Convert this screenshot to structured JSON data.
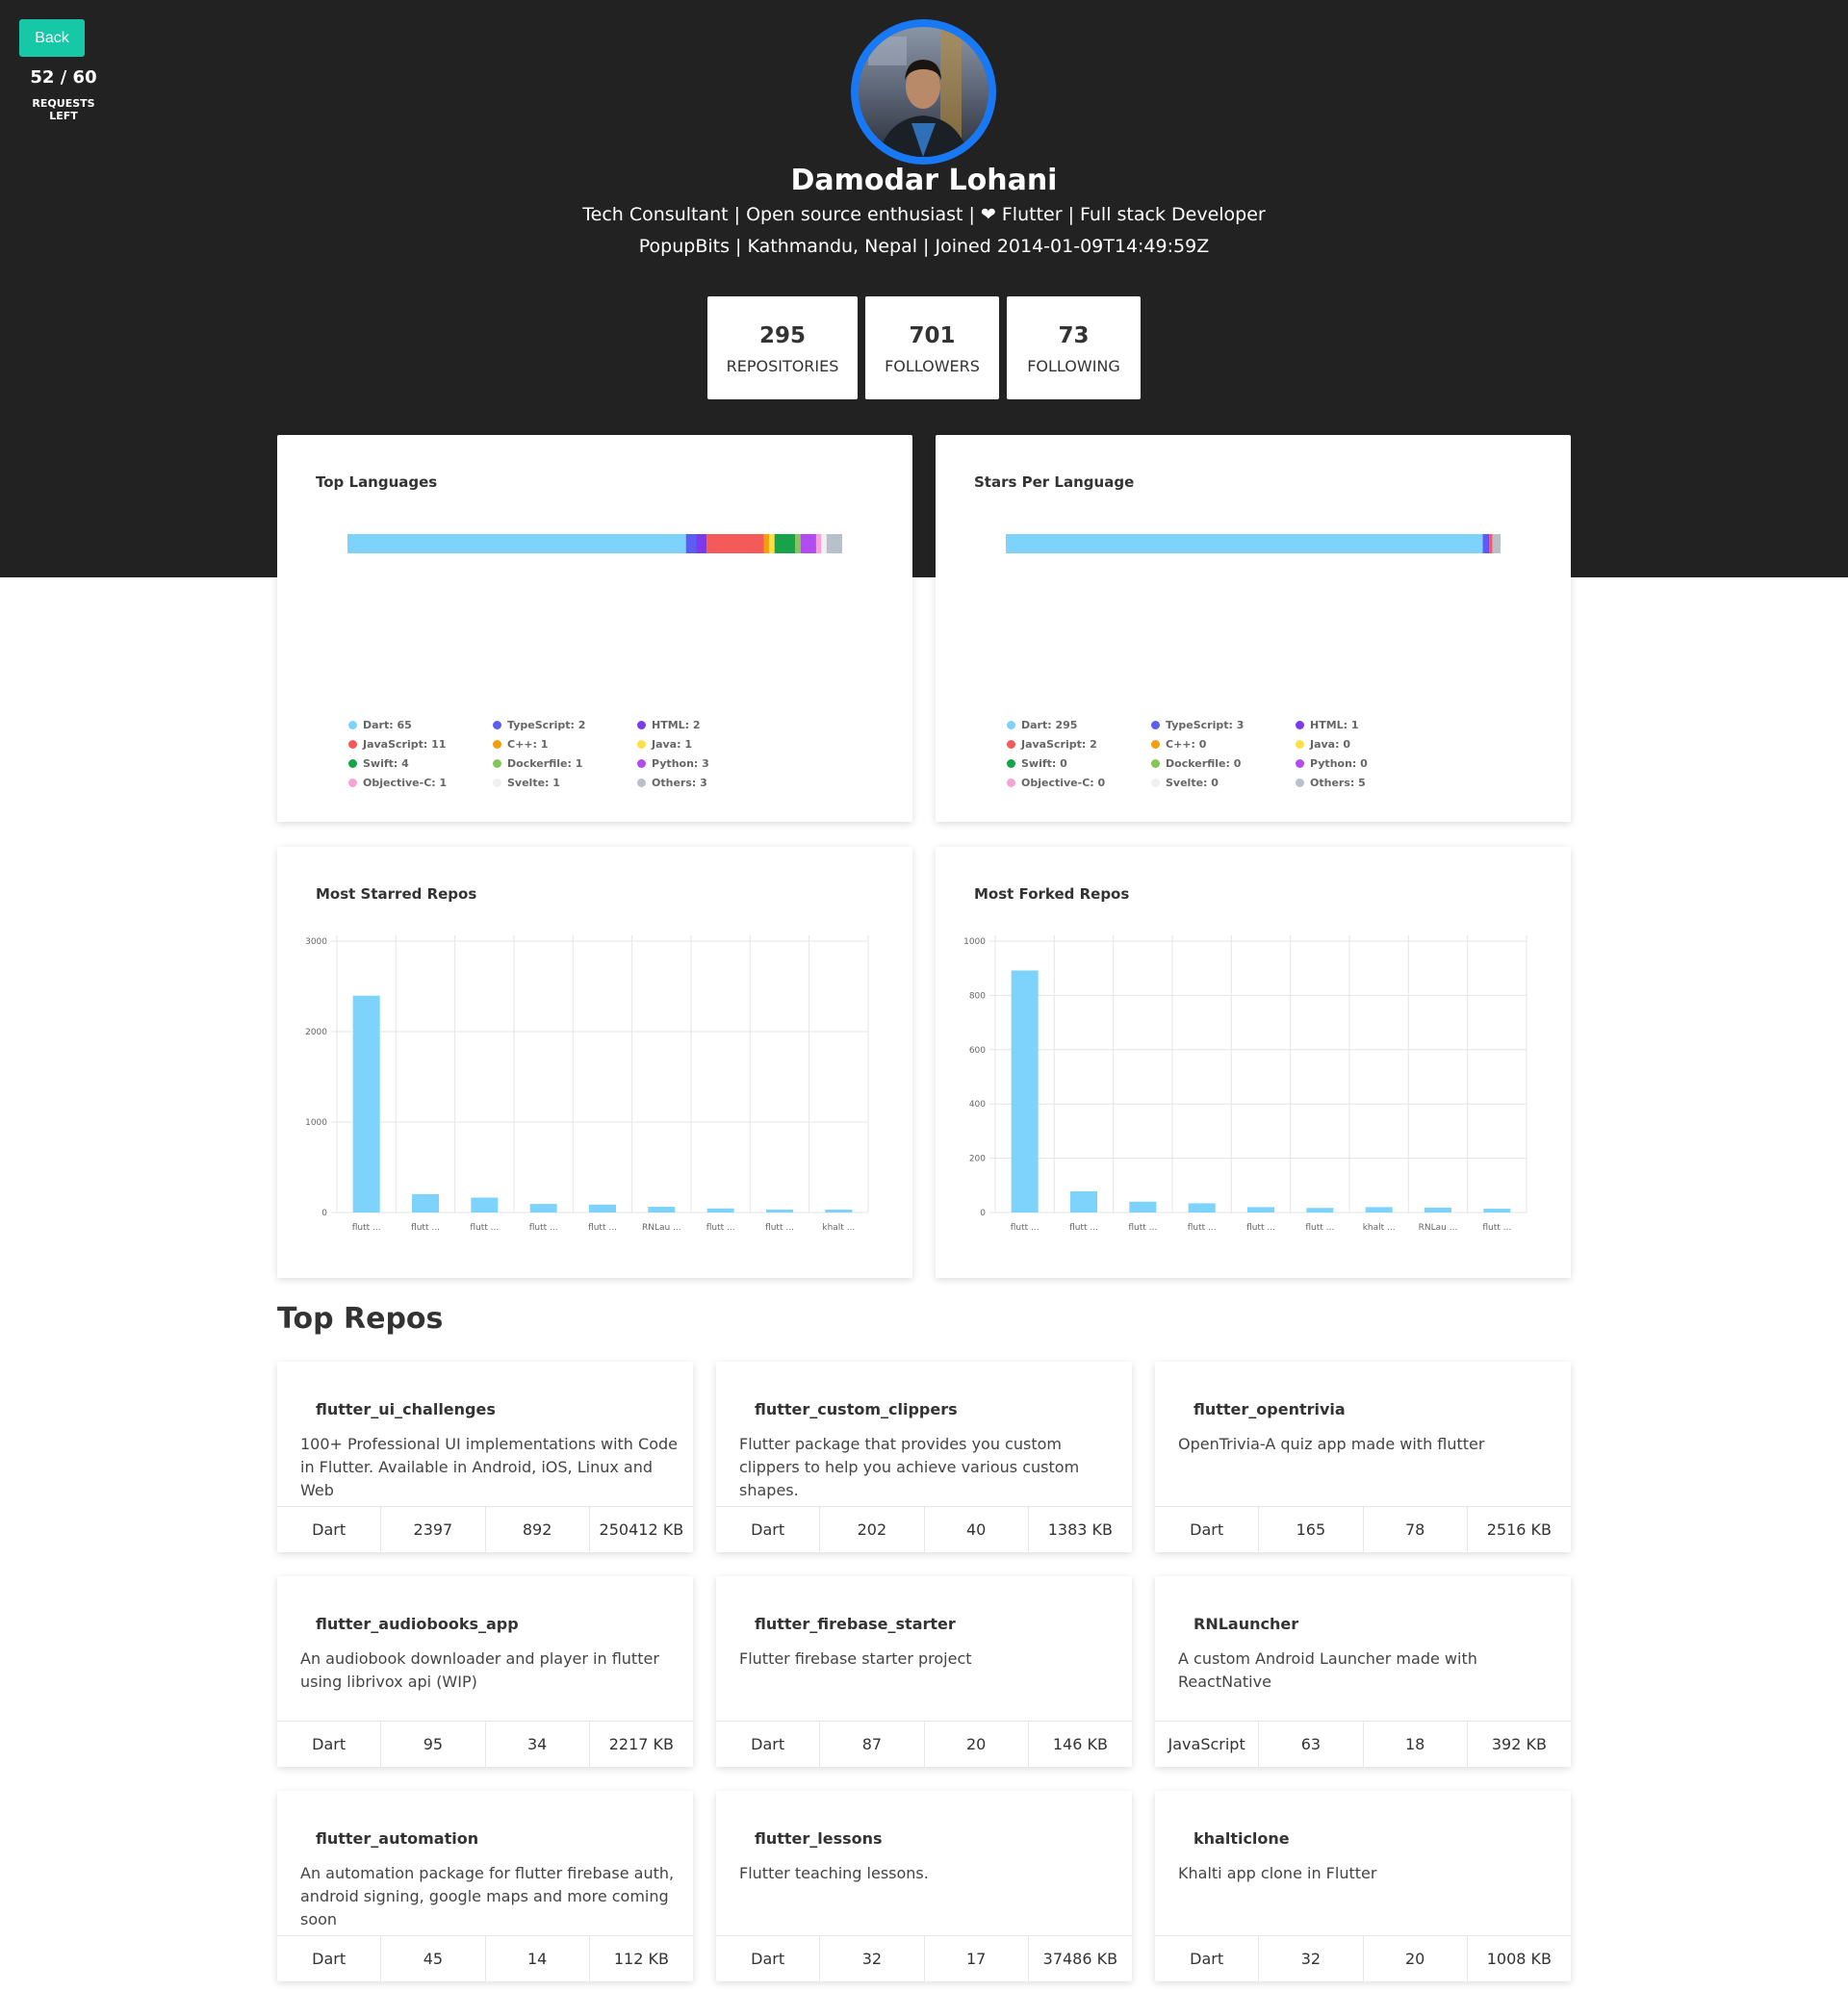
{
  "header": {
    "back_label": "Back",
    "requests_count": "52 / 60",
    "requests_label": "REQUESTS LEFT"
  },
  "profile": {
    "name": "Damodar Lohani",
    "bio": "Tech Consultant | Open source enthusiast | ❤ Flutter | Full stack Developer",
    "meta": "PopupBits | Kathmandu, Nepal | Joined 2014-01-09T14:49:59Z"
  },
  "stats": [
    {
      "value": "295",
      "label": "REPOSITORIES"
    },
    {
      "value": "701",
      "label": "FOLLOWERS"
    },
    {
      "value": "73",
      "label": "FOLLOWING"
    }
  ],
  "top_languages": {
    "title": "Top Languages",
    "legend": [
      {
        "label": "Dart: 65",
        "color": "#7dd3fc"
      },
      {
        "label": "TypeScript: 2",
        "color": "#5b5ef4"
      },
      {
        "label": "HTML: 2",
        "color": "#7c3aed"
      },
      {
        "label": "JavaScript: 11",
        "color": "#f55a5a"
      },
      {
        "label": "C++: 1",
        "color": "#f59e0b"
      },
      {
        "label": "Java: 1",
        "color": "#fde047"
      },
      {
        "label": "Swift: 4",
        "color": "#16a34a"
      },
      {
        "label": "Dockerfile: 1",
        "color": "#86c657"
      },
      {
        "label": "Python: 3",
        "color": "#b24cf0"
      },
      {
        "label": "Objective-C: 1",
        "color": "#f5a3d6"
      },
      {
        "label": "Svelte: 1",
        "color": "#f0f0f0"
      },
      {
        "label": "Others: 3",
        "color": "#b8c0cc"
      }
    ]
  },
  "stars_per_language": {
    "title": "Stars Per Language",
    "legend": [
      {
        "label": "Dart: 295",
        "color": "#7dd3fc"
      },
      {
        "label": "TypeScript: 3",
        "color": "#5b5ef4"
      },
      {
        "label": "HTML: 1",
        "color": "#7c3aed"
      },
      {
        "label": "JavaScript: 2",
        "color": "#f55a5a"
      },
      {
        "label": "C++: 0",
        "color": "#f59e0b"
      },
      {
        "label": "Java: 0",
        "color": "#fde047"
      },
      {
        "label": "Swift: 0",
        "color": "#16a34a"
      },
      {
        "label": "Dockerfile: 0",
        "color": "#86c657"
      },
      {
        "label": "Python: 0",
        "color": "#b24cf0"
      },
      {
        "label": "Objective-C: 0",
        "color": "#f5a3d6"
      },
      {
        "label": "Svelte: 0",
        "color": "#f0f0f0"
      },
      {
        "label": "Others: 5",
        "color": "#b8c0cc"
      }
    ]
  },
  "chart_data": [
    {
      "type": "bar",
      "orientation": "horizontal-stacked",
      "title": "Top Languages",
      "categories": [
        "Dart",
        "TypeScript",
        "HTML",
        "JavaScript",
        "C++",
        "Java",
        "Swift",
        "Dockerfile",
        "Python",
        "Objective-C",
        "Svelte",
        "Others"
      ],
      "values": [
        65,
        2,
        2,
        11,
        1,
        1,
        4,
        1,
        3,
        1,
        1,
        3
      ],
      "colors": [
        "#7dd3fc",
        "#5b5ef4",
        "#7c3aed",
        "#f55a5a",
        "#f59e0b",
        "#fde047",
        "#16a34a",
        "#86c657",
        "#b24cf0",
        "#f5a3d6",
        "#f0f0f0",
        "#b8c0cc"
      ]
    },
    {
      "type": "bar",
      "orientation": "horizontal-stacked",
      "title": "Stars Per Language",
      "categories": [
        "Dart",
        "TypeScript",
        "HTML",
        "JavaScript",
        "C++",
        "Java",
        "Swift",
        "Dockerfile",
        "Python",
        "Objective-C",
        "Svelte",
        "Others"
      ],
      "values": [
        295,
        3,
        1,
        2,
        0,
        0,
        0,
        0,
        0,
        0,
        0,
        5
      ],
      "colors": [
        "#7dd3fc",
        "#5b5ef4",
        "#7c3aed",
        "#f55a5a",
        "#f59e0b",
        "#fde047",
        "#16a34a",
        "#86c657",
        "#b24cf0",
        "#f5a3d6",
        "#f0f0f0",
        "#b8c0cc"
      ]
    },
    {
      "type": "bar",
      "title": "Most Starred Repos",
      "categories": [
        "flutt ...",
        "flutt ...",
        "flutt ...",
        "flutt ...",
        "flutt ...",
        "RNLau ...",
        "flutt ...",
        "flutt ...",
        "khalt ..."
      ],
      "values": [
        2397,
        202,
        165,
        95,
        87,
        63,
        45,
        32,
        32
      ],
      "yticks": [
        0,
        1000,
        2000,
        3000
      ],
      "ylim": [
        0,
        3000
      ],
      "color": "#7dd3fc",
      "grid": true
    },
    {
      "type": "bar",
      "title": "Most Forked Repos",
      "categories": [
        "flutt ...",
        "flutt ...",
        "flutt ...",
        "flutt ...",
        "flutt ...",
        "flutt ...",
        "khalt ...",
        "RNLau ...",
        "flutt ..."
      ],
      "values": [
        892,
        78,
        40,
        34,
        20,
        17,
        20,
        18,
        14
      ],
      "yticks": [
        0,
        200,
        400,
        600,
        800,
        1000
      ],
      "ylim": [
        0,
        1000
      ],
      "color": "#7dd3fc",
      "grid": true
    }
  ],
  "top_repos": {
    "heading": "Top Repos",
    "items": [
      {
        "name": "flutter_ui_challenges",
        "description": "100+ Professional UI implementations with Code in Flutter. Available in Android, iOS, Linux and Web",
        "language": "Dart",
        "stars": "2397",
        "forks": "892",
        "size": "250412 KB"
      },
      {
        "name": "flutter_custom_clippers",
        "description": "Flutter package that provides you custom clippers to help you achieve various custom shapes.",
        "language": "Dart",
        "stars": "202",
        "forks": "40",
        "size": "1383 KB"
      },
      {
        "name": "flutter_opentrivia",
        "description": "OpenTrivia-A quiz app made with flutter",
        "language": "Dart",
        "stars": "165",
        "forks": "78",
        "size": "2516 KB"
      },
      {
        "name": "flutter_audiobooks_app",
        "description": "An audiobook downloader and player in flutter using librivox api (WIP)",
        "language": "Dart",
        "stars": "95",
        "forks": "34",
        "size": "2217 KB"
      },
      {
        "name": "flutter_firebase_starter",
        "description": "Flutter firebase starter project",
        "language": "Dart",
        "stars": "87",
        "forks": "20",
        "size": "146 KB"
      },
      {
        "name": "RNLauncher",
        "description": "A custom Android Launcher made with ReactNative",
        "language": "JavaScript",
        "stars": "63",
        "forks": "18",
        "size": "392 KB"
      },
      {
        "name": "flutter_automation",
        "description": "An automation package for flutter firebase auth, android signing, google maps and more coming soon",
        "language": "Dart",
        "stars": "45",
        "forks": "14",
        "size": "112 KB"
      },
      {
        "name": "flutter_lessons",
        "description": "Flutter teaching lessons.",
        "language": "Dart",
        "stars": "32",
        "forks": "17",
        "size": "37486 KB"
      },
      {
        "name": "khalticlone",
        "description": "Khalti app clone in Flutter",
        "language": "Dart",
        "stars": "32",
        "forks": "20",
        "size": "1008 KB"
      }
    ]
  }
}
